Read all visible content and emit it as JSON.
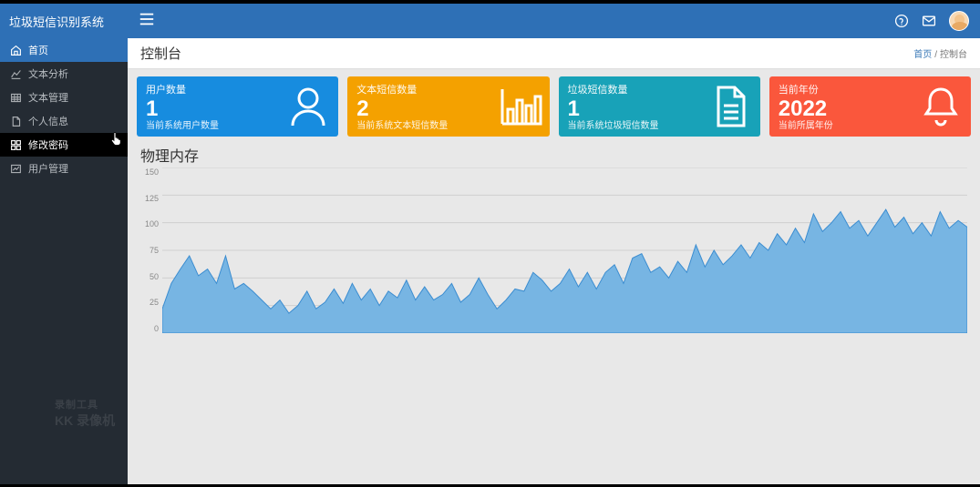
{
  "brand": "垃圾短信识别系统",
  "sidebar": {
    "items": [
      {
        "label": "首页",
        "icon": "home-icon",
        "state": "active"
      },
      {
        "label": "文本分析",
        "icon": "chart-icon",
        "state": ""
      },
      {
        "label": "文本管理",
        "icon": "table-icon",
        "state": ""
      },
      {
        "label": "个人信息",
        "icon": "doc-icon",
        "state": ""
      },
      {
        "label": "修改密码",
        "icon": "grid-icon",
        "state": "hover"
      },
      {
        "label": "用户管理",
        "icon": "chart2-icon",
        "state": ""
      }
    ]
  },
  "page": {
    "title": "控制台"
  },
  "breadcrumb": {
    "root": "首页",
    "sep": "/",
    "current": "控制台"
  },
  "cards": [
    {
      "title": "用户数量",
      "value": "1",
      "desc": "当前系统用户数量",
      "color": "c-blue",
      "icon": "user-icon"
    },
    {
      "title": "文本短信数量",
      "value": "2",
      "desc": "当前系统文本短信数量",
      "color": "c-orange",
      "icon": "bar-icon"
    },
    {
      "title": "垃圾短信数量",
      "value": "1",
      "desc": "当前系统垃圾短信数量",
      "color": "c-teal",
      "icon": "file-icon"
    },
    {
      "title": "当前年份",
      "value": "2022",
      "desc": "当前所属年份",
      "color": "c-red",
      "icon": "bell-icon"
    }
  ],
  "chart_title": "物理内存",
  "chart_data": {
    "type": "area",
    "title": "物理内存",
    "xlabel": "",
    "ylabel": "",
    "ylim": [
      0,
      150
    ],
    "yticks": [
      0,
      25,
      50,
      75,
      100,
      125,
      150
    ],
    "x": [
      0,
      1,
      2,
      3,
      4,
      5,
      6,
      7,
      8,
      9,
      10,
      11,
      12,
      13,
      14,
      15,
      16,
      17,
      18,
      19,
      20,
      21,
      22,
      23,
      24,
      25,
      26,
      27,
      28,
      29,
      30,
      31,
      32,
      33,
      34,
      35,
      36,
      37,
      38,
      39,
      40,
      41,
      42,
      43,
      44,
      45,
      46,
      47,
      48,
      49,
      50,
      51,
      52,
      53,
      54,
      55,
      56,
      57,
      58,
      59,
      60,
      61,
      62,
      63,
      64,
      65,
      66,
      67,
      68,
      69,
      70,
      71,
      72,
      73,
      74,
      75,
      76,
      77,
      78,
      79,
      80,
      81,
      82,
      83,
      84,
      85,
      86,
      87,
      88,
      89
    ],
    "values": [
      22,
      45,
      58,
      70,
      52,
      58,
      45,
      70,
      40,
      45,
      38,
      30,
      22,
      30,
      18,
      25,
      38,
      22,
      28,
      40,
      27,
      45,
      30,
      40,
      25,
      38,
      32,
      48,
      30,
      42,
      30,
      35,
      45,
      28,
      35,
      50,
      35,
      22,
      30,
      40,
      38,
      55,
      48,
      38,
      45,
      58,
      42,
      55,
      40,
      55,
      62,
      45,
      68,
      72,
      55,
      60,
      50,
      65,
      55,
      80,
      60,
      75,
      62,
      70,
      80,
      68,
      82,
      75,
      90,
      80,
      95,
      82,
      108,
      92,
      100,
      110,
      95,
      102,
      88,
      100,
      112,
      96,
      105,
      90,
      100,
      88,
      110,
      95,
      102,
      96
    ]
  },
  "watermark": {
    "line1": "录制工具",
    "line2": "KK 录像机"
  }
}
